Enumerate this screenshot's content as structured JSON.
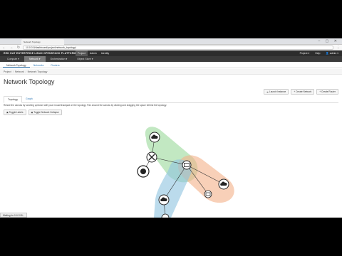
{
  "browser": {
    "tab_title": "Network Topology",
    "url": "10.0.0.8/dashboard/project/network_topology/",
    "window_controls": "– ▢ ✕",
    "nav_icons": "← → ↻"
  },
  "brand_bar": {
    "brand": "RED HAT ENTERPRISE LINUX OPENSTACK PLATFORM",
    "menu": [
      {
        "label": "Project",
        "active": true
      },
      {
        "label": "Admin",
        "active": false
      },
      {
        "label": "Identity",
        "active": false
      }
    ],
    "project_label": "Project ▾",
    "help_label": "Help",
    "user_label": "👤 admin ▾"
  },
  "sub_nav": [
    {
      "label": "Compute ▾",
      "active": false
    },
    {
      "label": "Network ▾",
      "active": true
    },
    {
      "label": "Orchestration ▾",
      "active": false
    },
    {
      "label": "Object Store ▾",
      "active": false
    }
  ],
  "network_tabs": [
    {
      "label": "Network Topology",
      "active": true
    },
    {
      "label": "Networks",
      "active": false
    },
    {
      "label": "Routers",
      "active": false
    }
  ],
  "breadcrumb": [
    "Project",
    "Network",
    "Network Topology"
  ],
  "page_title": "Network Topology",
  "actions": {
    "launch_instance": "☁ Launch Instance",
    "create_network": "+ Create Network",
    "create_router": "+ Create Router"
  },
  "view_tabs": [
    {
      "label": "Topology",
      "active": true
    },
    {
      "label": "Graph",
      "active": false
    }
  ],
  "help_text": "Resize the canvas by scrolling up/down with your mouse/trackpad on the topology. Pan around the canvas by clicking and dragging the space behind the topology.",
  "toggles": {
    "labels": "▣ Toggle Labels",
    "network_collapse": "▣ Toggle Network Collapse"
  },
  "status_bubble": "Waiting for 10.0.0.8...",
  "colors": {
    "network_green": "#8fd68f",
    "network_orange": "#f4b088",
    "network_blue": "#8ec3e0",
    "brand_bar": "#2d2d2d",
    "link": "#337ab7"
  },
  "topology_icons": {
    "cloud": "cloud-icon",
    "router": "router-icon",
    "external": "globe-icon",
    "instance": "server-icon"
  }
}
